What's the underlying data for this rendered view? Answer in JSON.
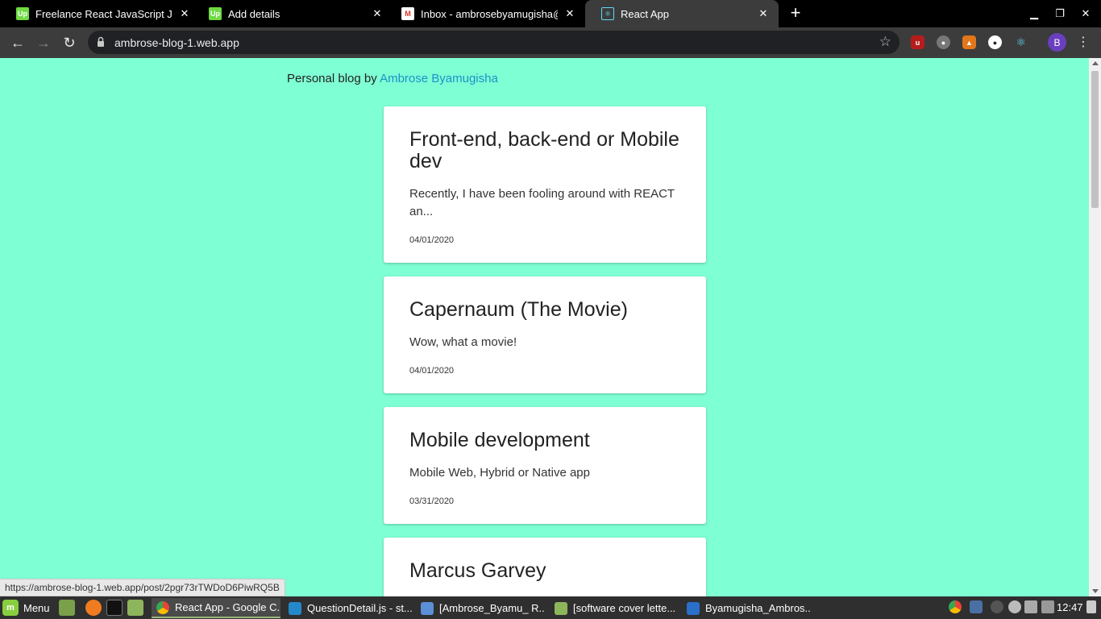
{
  "browser": {
    "tabs": [
      {
        "title": "Freelance React JavaScript Jobs",
        "favicon": "upwork-icon"
      },
      {
        "title": "Add details",
        "favicon": "upwork-icon"
      },
      {
        "title": "Inbox - ambrosebyamugisha@",
        "favicon": "gmail-icon"
      },
      {
        "title": "React App",
        "favicon": "react-icon",
        "active": true
      }
    ],
    "url": "ambrose-blog-1.web.app",
    "profile_initial": "B",
    "status_url": "https://ambrose-blog-1.web.app/post/2pgr73rTWDoD6PiwRQ5B"
  },
  "page": {
    "header_prefix": "Personal blog by ",
    "author": "Ambrose Byamugisha",
    "posts": [
      {
        "title": "Front-end, back-end or Mobile dev",
        "excerpt": "Recently, I have been fooling around with REACT an...",
        "date": "04/01/2020"
      },
      {
        "title": "Capernaum (The Movie)",
        "excerpt": "Wow, what a movie!",
        "date": "04/01/2020"
      },
      {
        "title": "Mobile development",
        "excerpt": "Mobile Web, Hybrid or Native app",
        "date": "03/31/2020"
      },
      {
        "title": "Marcus Garvey",
        "excerpt": "",
        "date": ""
      }
    ]
  },
  "taskbar": {
    "menu_label": "Menu",
    "tasks": [
      {
        "label": "React App - Google C...",
        "icon": "chrome-icon",
        "active": true
      },
      {
        "label": "QuestionDetail.js - st...",
        "icon": "vscode-icon"
      },
      {
        "label": "[Ambrose_Byamu_ R...",
        "icon": "document-viewer-icon"
      },
      {
        "label": "[software cover lette...",
        "icon": "folder-icon"
      },
      {
        "label": "Byamugisha_Ambros...",
        "icon": "writer-icon"
      }
    ],
    "clock": "12:47"
  },
  "colors": {
    "page_background": "#7fffd4",
    "link": "#1e90c8",
    "chrome_dark": "#3c3c3c"
  }
}
